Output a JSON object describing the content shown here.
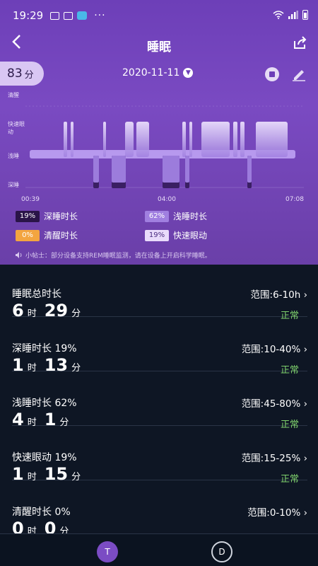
{
  "status_bar": {
    "time": "19:29",
    "dots": "···"
  },
  "header": {
    "title": "睡眠"
  },
  "score": {
    "value": "83",
    "unit": "分"
  },
  "date": "2020-11-11",
  "chart": {
    "y_labels": [
      "清醒",
      "快速眼动",
      "浅睡",
      "深睡"
    ],
    "x_labels": [
      "00:39",
      "04:00",
      "07:08"
    ],
    "colors": {
      "deep": "#3a1f63",
      "light": "#a07fe0",
      "rem": "#c9b0f2",
      "awake": "#f3a540"
    }
  },
  "legend": [
    {
      "pct": "19%",
      "label": "深睡时长",
      "chip_bg": "#2a1448",
      "chip_fg": "#ffffff"
    },
    {
      "pct": "62%",
      "label": "浅睡时长",
      "chip_bg": "#a07fe0",
      "chip_fg": "#ffffff"
    },
    {
      "pct": "0%",
      "label": "清醒时长",
      "chip_bg": "#f3a540",
      "chip_fg": "#ffffff"
    },
    {
      "pct": "19%",
      "label": "快速眼动",
      "chip_bg": "#e9dcfb",
      "chip_fg": "#4a2c80"
    }
  ],
  "tip": "小帖士：部分设备支持REM睡眠监测，请在设备上开启科学睡眠。",
  "rows": [
    {
      "label": "睡眠总时长",
      "range": "范围:6-10h",
      "h": "6",
      "h_unit": "时",
      "m": "29",
      "m_unit": "分",
      "status": "正常"
    },
    {
      "label": "深睡时长 19%",
      "range": "范围:10-40%",
      "h": "1",
      "h_unit": "时",
      "m": "13",
      "m_unit": "分",
      "status": "正常"
    },
    {
      "label": "浅睡时长 62%",
      "range": "范围:45-80%",
      "h": "4",
      "h_unit": "时",
      "m": "1",
      "m_unit": "分",
      "status": "正常"
    },
    {
      "label": "快速眼动 19%",
      "range": "范围:15-25%",
      "h": "1",
      "h_unit": "时",
      "m": "15",
      "m_unit": "分",
      "status": "正常"
    },
    {
      "label": "清醒时长 0%",
      "range": "范围:0-10%",
      "h": "0",
      "h_unit": "时",
      "m": "0",
      "m_unit": "分",
      "status": ""
    }
  ],
  "bottom_tabs": [
    {
      "label": "T"
    },
    {
      "label": "D"
    }
  ]
}
